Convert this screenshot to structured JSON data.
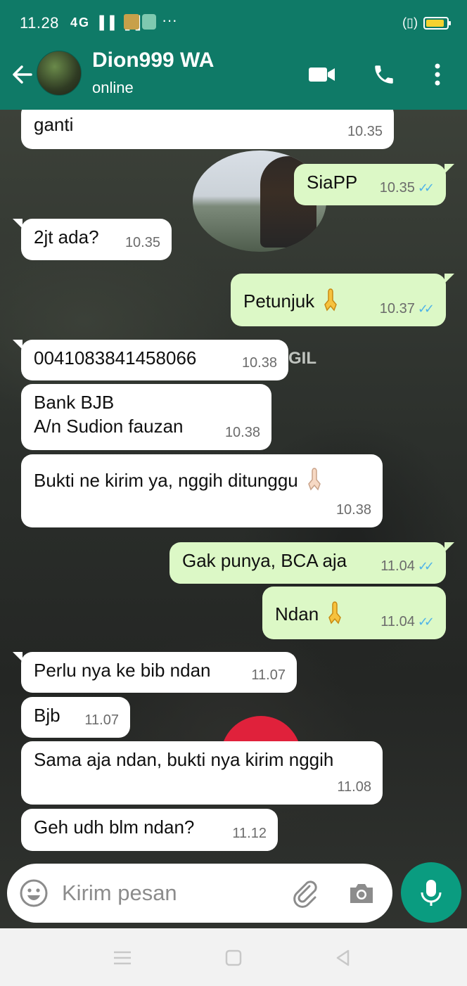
{
  "status_bar": {
    "time": "11.28",
    "signal_text": "4G ▐▐ ▐▐",
    "more_indicator": "···",
    "vibrate_icon_text": "(▯)",
    "battery_level": 0.9,
    "battery_color": "#f5d22f"
  },
  "header": {
    "contact_name": "Dion999 WA",
    "contact_status": "online",
    "color": "#0f7a67",
    "icons": [
      "back-arrow-icon",
      "video-call-icon",
      "voice-call-icon",
      "more-options-icon"
    ]
  },
  "chat": {
    "background_text": "GIL",
    "messages": [
      {
        "dir": "in",
        "text": "ganti",
        "time": "10.35"
      },
      {
        "dir": "out",
        "text": "SiaPP",
        "time": "10.35",
        "read": true
      },
      {
        "dir": "in",
        "text": "2jt ada?",
        "time": "10.35"
      },
      {
        "dir": "out",
        "text": "Petunjuk",
        "emoji": "folded-hands",
        "time": "10.37",
        "read": true
      },
      {
        "dir": "in",
        "text": "0041083841458066",
        "time": "10.38"
      },
      {
        "dir": "in",
        "text": "Bank BJB\nA/n Sudion fauzan",
        "time": "10.38"
      },
      {
        "dir": "in",
        "text": "Bukti ne kirim ya, nggih ditunggu",
        "emoji": "folded-hands",
        "time": "10.38"
      },
      {
        "dir": "out",
        "text": "Gak punya, BCA aja",
        "time": "11.04",
        "read": true
      },
      {
        "dir": "out",
        "text": "Ndan",
        "emoji": "folded-hands",
        "time": "11.04",
        "read": true
      },
      {
        "dir": "in",
        "text": "Perlu nya ke bib ndan",
        "time": "11.07"
      },
      {
        "dir": "in",
        "text": "Bjb",
        "time": "11.07"
      },
      {
        "dir": "in",
        "text": "Sama aja ndan, bukti nya kirim nggih",
        "time": "11.08"
      },
      {
        "dir": "in",
        "text": "Geh udh blm ndan?",
        "time": "11.12"
      }
    ]
  },
  "composer": {
    "placeholder": "Kirim pesan",
    "icons": [
      "emoji-icon",
      "attach-icon",
      "camera-icon",
      "mic-icon"
    ]
  },
  "nav_bar": {
    "icons": [
      "menu-icon",
      "home-icon",
      "back-icon"
    ]
  }
}
